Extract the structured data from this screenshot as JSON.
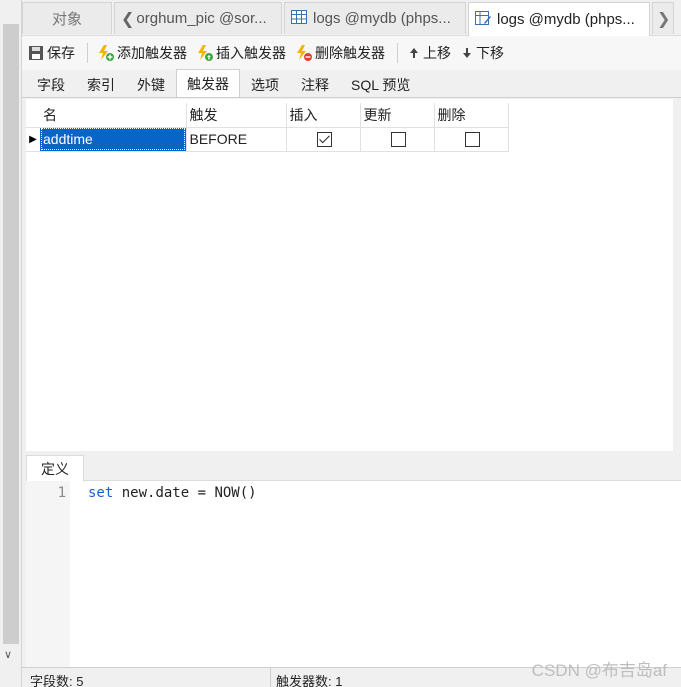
{
  "tabs": [
    {
      "label": "对象"
    },
    {
      "label": "orghum_pic @sor..."
    },
    {
      "label": "logs @mydb (phps..."
    },
    {
      "label": "logs @mydb (phps..."
    }
  ],
  "toolbar": {
    "save": "保存",
    "add_trigger": "添加触发器",
    "insert_trigger": "插入触发器",
    "delete_trigger": "删除触发器",
    "move_up": "上移",
    "move_down": "下移"
  },
  "subtabs": [
    "字段",
    "索引",
    "外键",
    "触发器",
    "选项",
    "注释",
    "SQL 预览"
  ],
  "grid": {
    "columns": [
      "名",
      "触发",
      "插入",
      "更新",
      "删除"
    ],
    "rows": [
      {
        "name": "addtime",
        "timing": "BEFORE",
        "insert": true,
        "update": false,
        "delete": false
      }
    ]
  },
  "definition": {
    "tab_label": "定义",
    "line_number": "1",
    "code_keyword": "set",
    "code_rest": " new.date = NOW()"
  },
  "status": {
    "fields": "字段数: 5",
    "triggers": "触发器数: 1"
  },
  "watermark": "CSDN @布吉岛af"
}
